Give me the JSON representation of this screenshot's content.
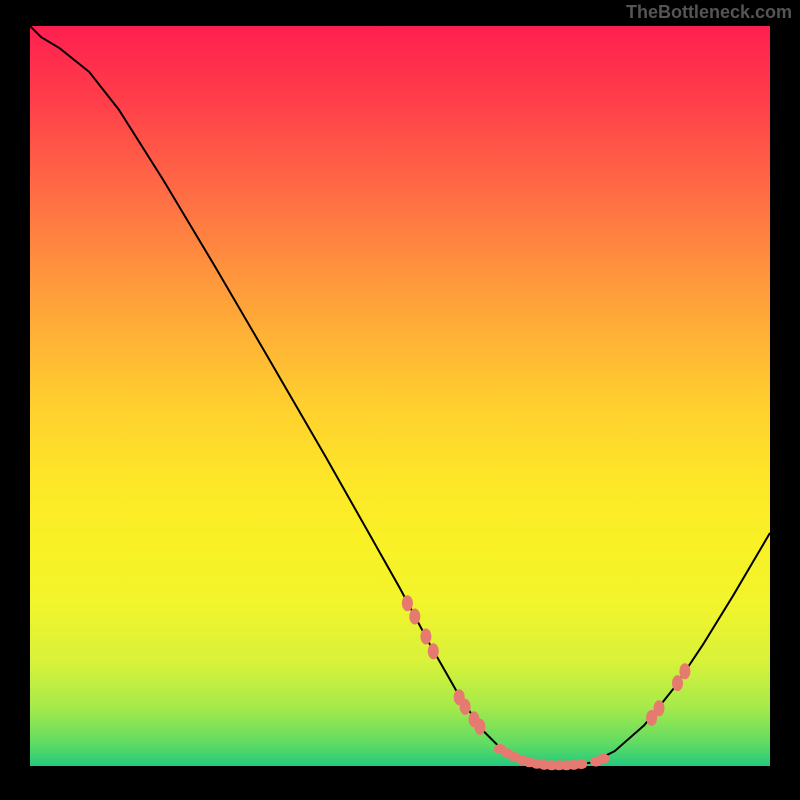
{
  "attribution": "TheBottleneck.com",
  "chart_data": {
    "type": "line",
    "title": "",
    "xlabel": "",
    "ylabel": "",
    "xlim": [
      0,
      100
    ],
    "ylim": [
      0,
      100
    ],
    "curve_points": [
      {
        "x": 0,
        "y": 100
      },
      {
        "x": 1.5,
        "y": 98.5
      },
      {
        "x": 4,
        "y": 97
      },
      {
        "x": 8,
        "y": 93.8
      },
      {
        "x": 12,
        "y": 88.7
      },
      {
        "x": 18,
        "y": 79.2
      },
      {
        "x": 25,
        "y": 67.5
      },
      {
        "x": 32,
        "y": 55.5
      },
      {
        "x": 40,
        "y": 41.7
      },
      {
        "x": 46,
        "y": 31.1
      },
      {
        "x": 50,
        "y": 24.0
      },
      {
        "x": 54,
        "y": 16.5
      },
      {
        "x": 58,
        "y": 9.5
      },
      {
        "x": 61,
        "y": 5.0
      },
      {
        "x": 64,
        "y": 2.0
      },
      {
        "x": 67,
        "y": 0.5
      },
      {
        "x": 70,
        "y": 0.0
      },
      {
        "x": 73,
        "y": 0.0
      },
      {
        "x": 76,
        "y": 0.5
      },
      {
        "x": 79,
        "y": 2.0
      },
      {
        "x": 83,
        "y": 5.5
      },
      {
        "x": 87,
        "y": 10.5
      },
      {
        "x": 91,
        "y": 16.5
      },
      {
        "x": 95,
        "y": 23.0
      },
      {
        "x": 100,
        "y": 31.5
      }
    ],
    "left_descent_markers": [
      {
        "x": 51.0,
        "y": 22.0
      },
      {
        "x": 52.0,
        "y": 20.2
      },
      {
        "x": 53.5,
        "y": 17.5
      },
      {
        "x": 54.5,
        "y": 15.5
      },
      {
        "x": 58.0,
        "y": 9.3
      },
      {
        "x": 58.8,
        "y": 8.0
      },
      {
        "x": 60.0,
        "y": 6.3
      },
      {
        "x": 60.8,
        "y": 5.3
      }
    ],
    "bottom_markers": [
      {
        "x": 63.5,
        "y": 2.3
      },
      {
        "x": 64.5,
        "y": 1.7
      },
      {
        "x": 65.5,
        "y": 1.2
      },
      {
        "x": 66.5,
        "y": 0.8
      },
      {
        "x": 67.5,
        "y": 0.5
      },
      {
        "x": 68.5,
        "y": 0.3
      },
      {
        "x": 69.5,
        "y": 0.15
      },
      {
        "x": 70.5,
        "y": 0.1
      },
      {
        "x": 71.5,
        "y": 0.1
      },
      {
        "x": 72.5,
        "y": 0.1
      },
      {
        "x": 73.5,
        "y": 0.15
      },
      {
        "x": 74.5,
        "y": 0.25
      },
      {
        "x": 76.5,
        "y": 0.6
      },
      {
        "x": 77.5,
        "y": 1.0
      }
    ],
    "right_ascent_markers": [
      {
        "x": 84.0,
        "y": 6.5
      },
      {
        "x": 85.0,
        "y": 7.8
      },
      {
        "x": 87.5,
        "y": 11.2
      },
      {
        "x": 88.5,
        "y": 12.8
      }
    ]
  }
}
